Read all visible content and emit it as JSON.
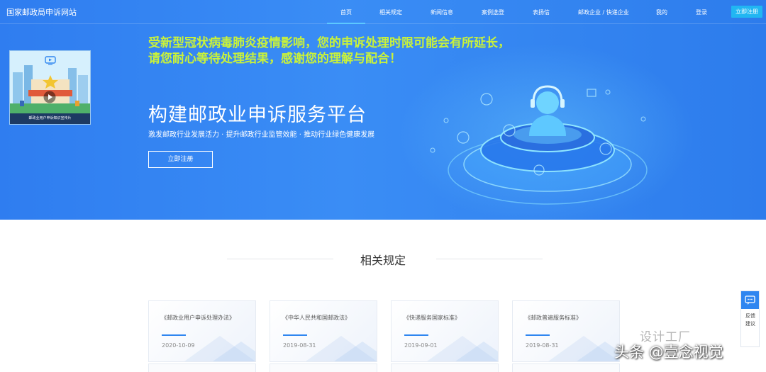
{
  "header": {
    "site_title": "国家邮政局申诉网站",
    "nav": [
      {
        "label": "首页",
        "active": true
      },
      {
        "label": "相关规定"
      },
      {
        "label": "新闻信息"
      },
      {
        "label": "案例选登"
      },
      {
        "label": "表扬信"
      },
      {
        "label": "邮政企业 / 快递企业"
      },
      {
        "label": "我的"
      },
      {
        "label": "登录"
      }
    ],
    "register_label": "立即注册"
  },
  "hero": {
    "notice_line1": "受新型冠状病毒肺炎疫情影响，您的申诉处理时限可能会有所延长，",
    "notice_line2": "请您耐心等待处理结果，感谢您的理解与配合！",
    "title": "构建邮政业申诉服务平台",
    "subtitle": "激发邮政行业发展活力 · 提升邮政行业监管效能 · 推动行业绿色健康发展",
    "button_label": "立即注册",
    "video_caption": "邮政业用户申诉知识宣传片"
  },
  "section": {
    "title": "相关规定",
    "cards": [
      {
        "title": "《邮政业用户申诉处理办法》",
        "date": "2020-10-09"
      },
      {
        "title": "《中华人民共和国邮政法》",
        "date": "2019-08-31"
      },
      {
        "title": "《快递服务国家标准》",
        "date": "2019-09-01"
      },
      {
        "title": "《邮政普遍服务标准》",
        "date": "2019-08-31"
      }
    ]
  },
  "feedback": {
    "label": "反馈建议"
  },
  "watermark": {
    "text": "头条 @壹念视觉",
    "small_text": "设计工厂"
  },
  "colors": {
    "hero_blue": "#2f7df0",
    "notice_yellow": "#c9f23a",
    "accent": "#2f86f0",
    "register_button": "#21b6f2"
  }
}
